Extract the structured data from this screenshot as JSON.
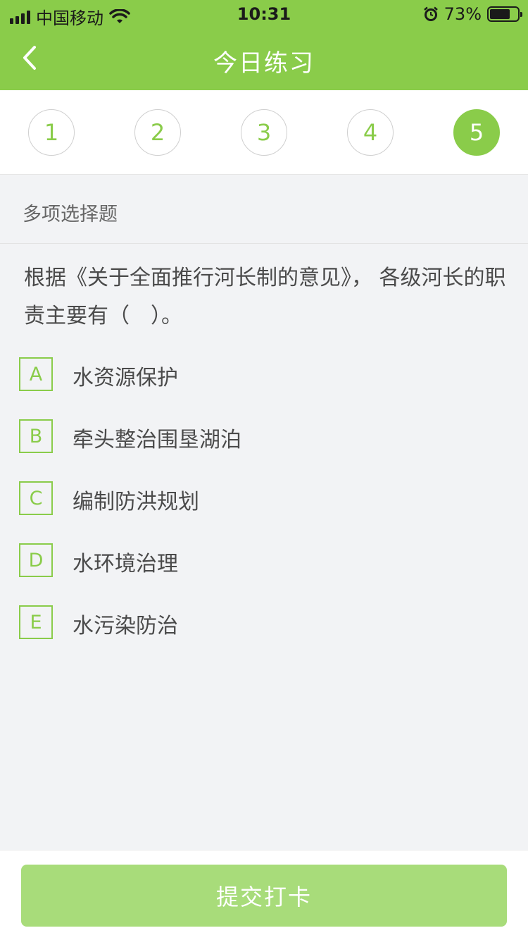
{
  "status": {
    "carrier": "中国移动",
    "time": "10:31",
    "battery": "73%",
    "battery_level": 0.73
  },
  "header": {
    "title": "今日练习",
    "back_icon": "chevron-left-icon"
  },
  "steps": [
    "1",
    "2",
    "3",
    "4",
    "5"
  ],
  "active_step": "5",
  "question": {
    "type": "多项选择题",
    "text": "根据《关于全面推行河长制的意见》， 各级河长的职责主要有（　）。",
    "options": [
      {
        "letter": "A",
        "text": "水资源保护"
      },
      {
        "letter": "B",
        "text": "牵头整治围垦湖泊"
      },
      {
        "letter": "C",
        "text": "编制防洪规划"
      },
      {
        "letter": "D",
        "text": "水环境治理"
      },
      {
        "letter": "E",
        "text": "水污染防治"
      }
    ]
  },
  "footer": {
    "submit_label": "提交打卡"
  },
  "colors": {
    "primary": "#8acc4a",
    "submit_disabled": "#a8dc7a"
  }
}
